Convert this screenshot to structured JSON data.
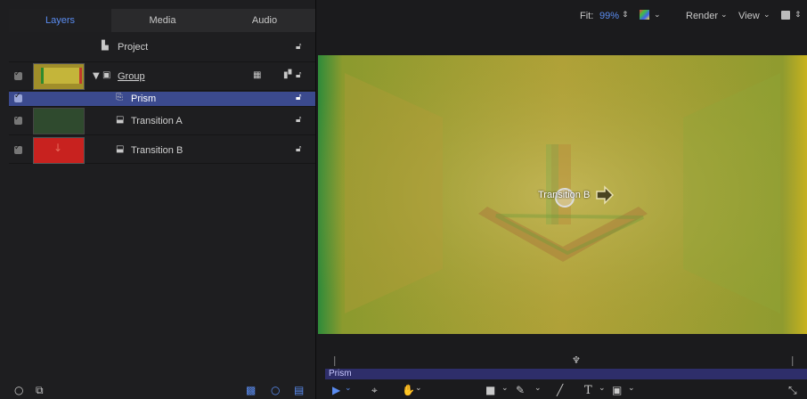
{
  "tabs": [
    "Layers",
    "Media",
    "Audio"
  ],
  "layers": {
    "project": "Project",
    "group": "Group",
    "prism": "Prism",
    "transition_a": "Transition A",
    "transition_b": "Transition B"
  },
  "topbar": {
    "fit_label": "Fit:",
    "fit_value": "99%",
    "render": "Render",
    "view": "View"
  },
  "canvas": {
    "overlay_label": "Transition B"
  },
  "timeline": {
    "clip_label": "Prism"
  },
  "colors": {
    "accent_blue": "#5a8cf0",
    "selection": "#3b4a8e",
    "canvas_yellow": "#a69a32",
    "canvas_green": "#228b3a",
    "thumb_red": "#c8221f"
  }
}
